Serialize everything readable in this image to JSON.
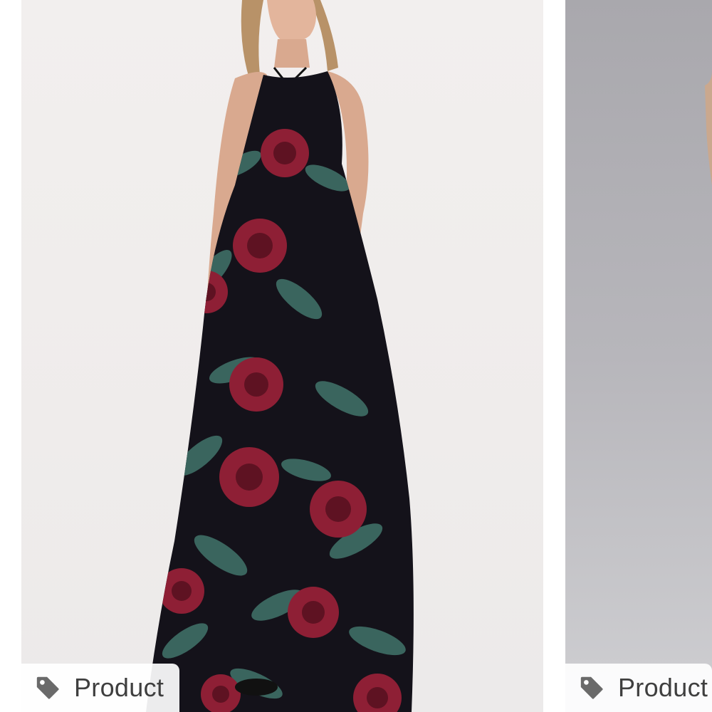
{
  "cards": [
    {
      "tag_label": "Product",
      "tag_icon": "price-tag-icon",
      "image": "floral-maxi-dress-photo",
      "background": "#efeceb"
    },
    {
      "tag_label": "Product",
      "tag_icon": "price-tag-icon",
      "image": "product-photo-partial",
      "background": "#b7b6bb"
    }
  ],
  "colors": {
    "dress_base": "#14121a",
    "rose": "#8e1f35",
    "leaf": "#3f6f66",
    "skin": "#d9a98f",
    "chip_text": "#3f3f3f",
    "tag_icon": "#6a6a6a"
  }
}
